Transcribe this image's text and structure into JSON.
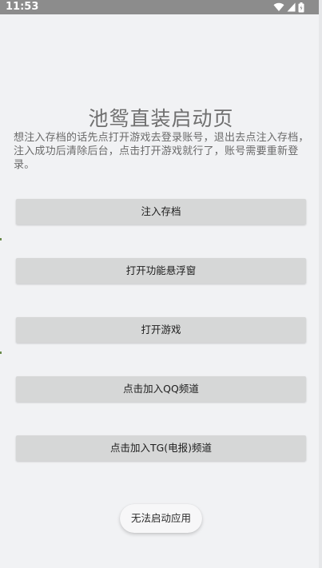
{
  "status_bar": {
    "time": "11:53",
    "icons": [
      "wifi-icon",
      "signal-icon",
      "battery-icon"
    ]
  },
  "page": {
    "title": "池鸳直装启动页",
    "instructions": "想注入存档的话先点打开游戏去登录账号，退出去点注入存档，注入成功后清除后台，点击打开游戏就行了，账号需要重新登录。"
  },
  "buttons": {
    "inject_save": "注入存档",
    "open_floating_window": "打开功能悬浮窗",
    "open_game": "打开游戏",
    "join_qq_channel": "点击加入QQ频道",
    "join_tg_channel": "点击加入TG(电报)频道",
    "cannot_launch": "无法启动应用"
  },
  "colors": {
    "background": "#f1f2f4",
    "status_bar": "#8c8c8c",
    "button_gray": "#d6d7d7",
    "title_text": "#6f6f6f"
  }
}
